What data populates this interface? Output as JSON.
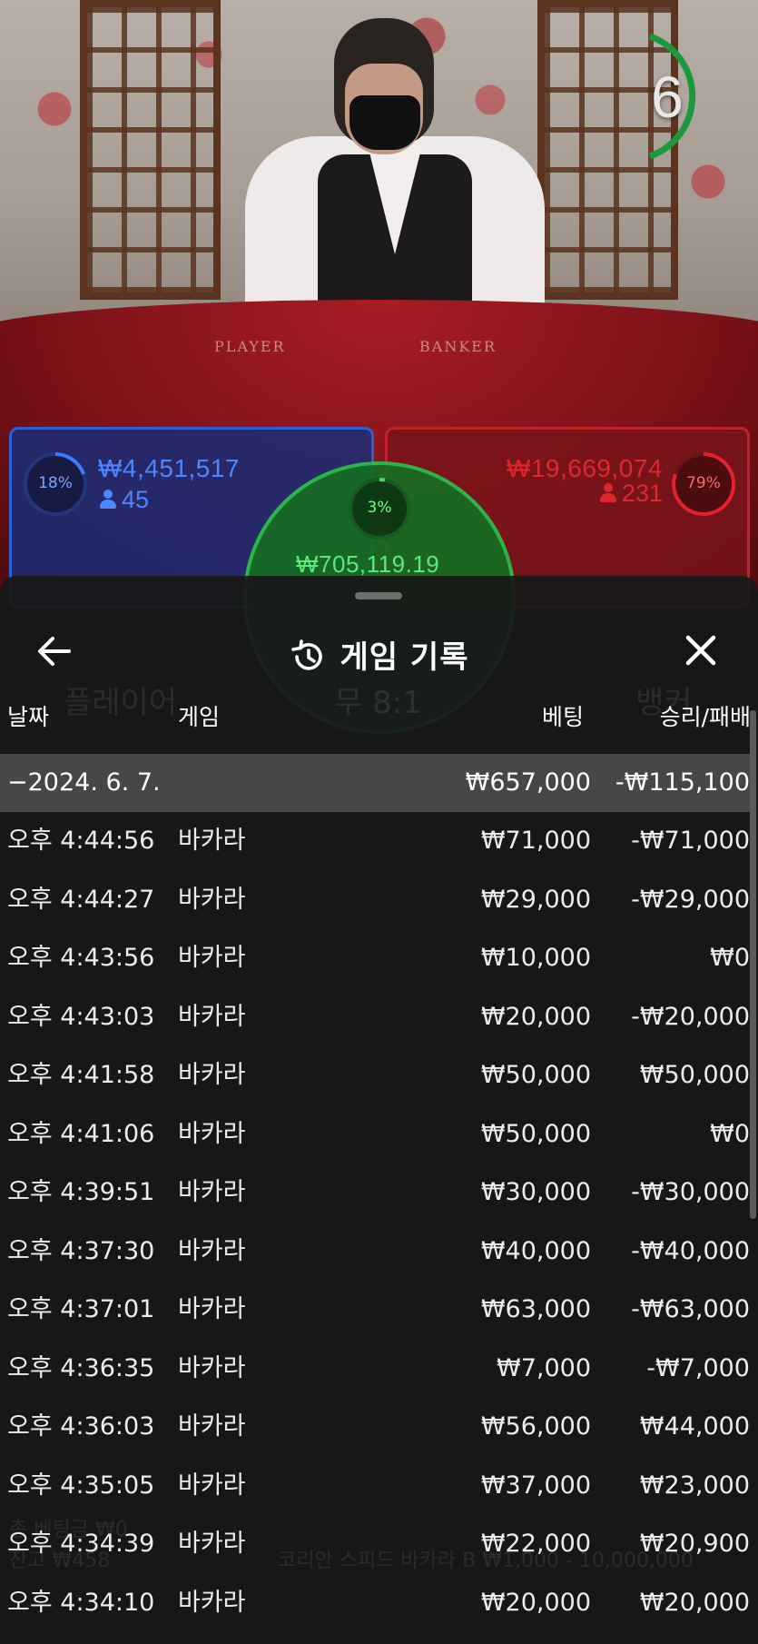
{
  "video": {
    "countdown": "6",
    "table_labels": {
      "player": "PLAYER",
      "banker": "BANKER"
    }
  },
  "bets": {
    "player": {
      "percent": "18%",
      "amount": "₩4,451,517",
      "count": "45",
      "color": "#2a62d6"
    },
    "banker": {
      "percent": "79%",
      "amount": "₩19,669,074",
      "count": "231",
      "color": "#d0222c"
    },
    "tie": {
      "percent": "3%",
      "amount": "₩705,119.19",
      "color": "#2cb44a"
    }
  },
  "sheet": {
    "title": "게임 기록",
    "icons": {
      "back": "arrow-left-icon",
      "close": "close-icon",
      "title": "history-icon"
    },
    "columns": {
      "date": "날짜",
      "game": "게임",
      "bet": "베팅",
      "result": "승리/패배"
    },
    "date_group": {
      "label": "−2024. 6. 7.",
      "bet": "₩657,000",
      "result": "-₩115,100"
    },
    "rows": [
      {
        "time": "오후 4:44:56",
        "game": "바카라",
        "bet": "₩71,000",
        "result": "-₩71,000"
      },
      {
        "time": "오후 4:44:27",
        "game": "바카라",
        "bet": "₩29,000",
        "result": "-₩29,000"
      },
      {
        "time": "오후 4:43:56",
        "game": "바카라",
        "bet": "₩10,000",
        "result": "₩0"
      },
      {
        "time": "오후 4:43:03",
        "game": "바카라",
        "bet": "₩20,000",
        "result": "-₩20,000"
      },
      {
        "time": "오후 4:41:58",
        "game": "바카라",
        "bet": "₩50,000",
        "result": "₩50,000"
      },
      {
        "time": "오후 4:41:06",
        "game": "바카라",
        "bet": "₩50,000",
        "result": "₩0"
      },
      {
        "time": "오후 4:39:51",
        "game": "바카라",
        "bet": "₩30,000",
        "result": "-₩30,000"
      },
      {
        "time": "오후 4:37:30",
        "game": "바카라",
        "bet": "₩40,000",
        "result": "-₩40,000"
      },
      {
        "time": "오후 4:37:01",
        "game": "바카라",
        "bet": "₩63,000",
        "result": "-₩63,000"
      },
      {
        "time": "오후 4:36:35",
        "game": "바카라",
        "bet": "₩7,000",
        "result": "-₩7,000"
      },
      {
        "time": "오후 4:36:03",
        "game": "바카라",
        "bet": "₩56,000",
        "result": "₩44,000"
      },
      {
        "time": "오후 4:35:05",
        "game": "바카라",
        "bet": "₩37,000",
        "result": "₩23,000"
      },
      {
        "time": "오후 4:34:39",
        "game": "바카라",
        "bet": "₩22,000",
        "result": "₩20,900"
      },
      {
        "time": "오후 4:34:10",
        "game": "바카라",
        "bet": "₩20,000",
        "result": "₩20,000"
      }
    ]
  },
  "background_ui": {
    "player": "플레이어",
    "tie": "무 8:1",
    "banker": "뱅커",
    "table_name": "코리안 스피드 바카라 B ₩1,000 - 10,000,000",
    "balance": "잔고 ₩458",
    "total_bet": "총 베팅금 ₩0"
  }
}
